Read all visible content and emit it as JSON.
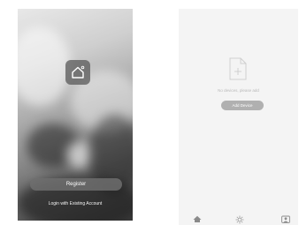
{
  "welcome_screen": {
    "register_label": "Register",
    "login_label": "Login with Existing Account",
    "logo_icon": "home-icon"
  },
  "device_screen": {
    "empty_message": "No devices, please add",
    "add_device_label": "Add Device",
    "empty_icon": "add-document-icon",
    "tabs": [
      {
        "icon": "home-icon"
      },
      {
        "icon": "sun-icon"
      },
      {
        "icon": "profile-icon"
      }
    ]
  }
}
